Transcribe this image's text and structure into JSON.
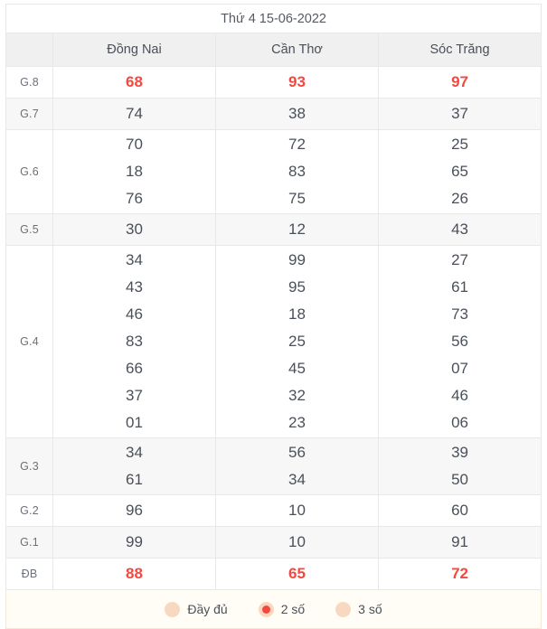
{
  "header": {
    "date_label": "Thứ 4 15-06-2022",
    "prize_column_label": "",
    "provinces": [
      "Đồng Nai",
      "Cần Thơ",
      "Sóc Trăng"
    ]
  },
  "colors": {
    "highlight_red": "#f4483f",
    "text": "#4a5059",
    "header_bg": "#f0f0f0",
    "row_shaded_bg": "#f7f7f7",
    "row_plain_bg": "#ffffff",
    "border": "#e8e8e8",
    "footer_bg": "#fffdf5",
    "radio_idle": "#f7d9c2"
  },
  "rows": [
    {
      "prize": "G.8",
      "highlight": true,
      "shaded": false,
      "values": [
        [
          "68"
        ],
        [
          "93"
        ],
        [
          "97"
        ]
      ]
    },
    {
      "prize": "G.7",
      "highlight": false,
      "shaded": true,
      "values": [
        [
          "74"
        ],
        [
          "38"
        ],
        [
          "37"
        ]
      ]
    },
    {
      "prize": "G.6",
      "highlight": false,
      "shaded": false,
      "values": [
        [
          "70",
          "18",
          "76"
        ],
        [
          "72",
          "83",
          "75"
        ],
        [
          "25",
          "65",
          "26"
        ]
      ]
    },
    {
      "prize": "G.5",
      "highlight": false,
      "shaded": true,
      "values": [
        [
          "30"
        ],
        [
          "12"
        ],
        [
          "43"
        ]
      ]
    },
    {
      "prize": "G.4",
      "highlight": false,
      "shaded": false,
      "values": [
        [
          "34",
          "43",
          "46",
          "83",
          "66",
          "37",
          "01"
        ],
        [
          "99",
          "95",
          "18",
          "25",
          "45",
          "32",
          "23"
        ],
        [
          "27",
          "61",
          "73",
          "56",
          "07",
          "46",
          "06"
        ]
      ]
    },
    {
      "prize": "G.3",
      "highlight": false,
      "shaded": true,
      "values": [
        [
          "34",
          "61"
        ],
        [
          "56",
          "34"
        ],
        [
          "39",
          "50"
        ]
      ]
    },
    {
      "prize": "G.2",
      "highlight": false,
      "shaded": false,
      "values": [
        [
          "96"
        ],
        [
          "10"
        ],
        [
          "60"
        ]
      ]
    },
    {
      "prize": "G.1",
      "highlight": false,
      "shaded": true,
      "values": [
        [
          "99"
        ],
        [
          "10"
        ],
        [
          "91"
        ]
      ]
    },
    {
      "prize": "ĐB",
      "highlight": true,
      "shaded": false,
      "values": [
        [
          "88"
        ],
        [
          "65"
        ],
        [
          "72"
        ]
      ]
    }
  ],
  "footer": {
    "options": [
      {
        "label": "Đầy đủ",
        "selected": false
      },
      {
        "label": "2 số",
        "selected": true
      },
      {
        "label": "3 số",
        "selected": false
      }
    ]
  }
}
